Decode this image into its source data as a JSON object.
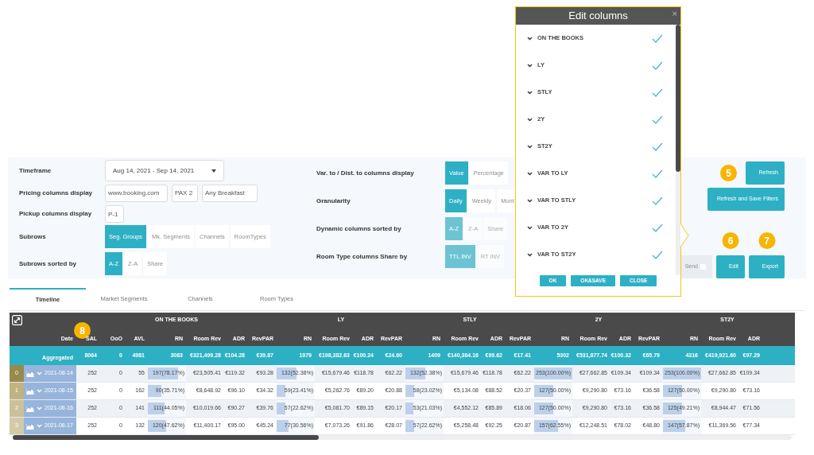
{
  "filters_left": [
    {
      "kind": "dropdown",
      "label": "Timeframe",
      "value": "Aug 14, 2021 - Sep 14, 2021"
    },
    {
      "kind": "fields",
      "label": "Pricing columns display",
      "values": [
        "www.booking.com",
        "PAX 2",
        "Any Breakfast"
      ]
    },
    {
      "kind": "fields",
      "label": "Pickup columns display",
      "values": [
        "P-1"
      ]
    },
    {
      "kind": "segmented",
      "label": "Subrows",
      "disabled": false,
      "options": [
        {
          "label": "Seg. Groups",
          "selected": true
        },
        {
          "label": "Mk. Segments",
          "selected": false
        },
        {
          "label": "Channels",
          "selected": false
        },
        {
          "label": "RoomTypes",
          "selected": false
        }
      ]
    },
    {
      "kind": "segmented",
      "label": "Subrows sorted by",
      "disabled": false,
      "options": [
        {
          "label": "A-Z",
          "selected": true
        },
        {
          "label": "Z-A",
          "selected": false
        },
        {
          "label": "Share",
          "selected": false
        }
      ]
    }
  ],
  "filters_middle": [
    {
      "kind": "segmented",
      "label": "Var. to / Dist. to columns display",
      "disabled": false,
      "options": [
        {
          "label": "Value",
          "selected": true
        },
        {
          "label": "Percentage",
          "selected": false
        }
      ]
    },
    {
      "kind": "segmented",
      "label": "Granularity",
      "disabled": false,
      "options": [
        {
          "label": "Daily",
          "selected": true
        },
        {
          "label": "Weekly",
          "selected": false
        },
        {
          "label": "Mont",
          "selected": false
        }
      ]
    },
    {
      "kind": "segmented",
      "label": "Dynamic columns sorted by",
      "disabled": true,
      "options": [
        {
          "label": "A-Z",
          "selected": true
        },
        {
          "label": "Z-A",
          "selected": false
        },
        {
          "label": "Share",
          "selected": false
        }
      ]
    },
    {
      "kind": "segmented",
      "label": "Room Type columns Share by",
      "disabled": true,
      "options": [
        {
          "label": "TTL INV",
          "selected": true
        },
        {
          "label": "RT INV",
          "selected": false
        }
      ]
    }
  ],
  "actions": {
    "top": [
      {
        "label": "Refresh",
        "callout": "5",
        "disabled": false
      },
      {
        "label": "Refresh and Save Filters",
        "disabled": false
      }
    ],
    "bottom": [
      {
        "label": "Send",
        "disabled": true
      },
      {
        "label": "Edit",
        "callout": "6",
        "disabled": false
      },
      {
        "label": "Export",
        "callout": "7",
        "disabled": false
      }
    ]
  },
  "tabs": [
    {
      "label": "Timeline",
      "selected": true
    },
    {
      "label": "Market Segments",
      "selected": false
    },
    {
      "label": "Channels",
      "selected": false
    },
    {
      "label": "Room Types",
      "selected": false
    }
  ],
  "table": {
    "lead_columns": [
      {
        "label": "Date",
        "callout": "8"
      },
      {
        "label": "SAL"
      },
      {
        "label": "OoO"
      },
      {
        "label": "AVL"
      }
    ],
    "groups": [
      {
        "label": "ON THE BOOKS",
        "columns": [
          "RN",
          "Room Rev",
          "ADR",
          "RevPAR"
        ]
      },
      {
        "label": "LY",
        "columns": [
          "RN",
          "Room Rev",
          "ADR",
          "RevPAR"
        ]
      },
      {
        "label": "STLY",
        "columns": [
          "RN",
          "Room Rev",
          "ADR",
          "RevPAR"
        ]
      },
      {
        "label": "2Y",
        "columns": [
          "RN",
          "Room Rev",
          "ADR",
          "RevPAR"
        ]
      },
      {
        "label": "ST2Y",
        "columns": [
          "RN",
          "Room Rev",
          "ADR"
        ]
      }
    ],
    "aggregated": {
      "label": "Aggregated",
      "cells": [
        "8064",
        "0",
        "4981",
        "3083",
        "€321,499.28",
        "€104.28",
        "€39.87",
        "1979",
        "€198,382.63",
        "€100.24",
        "€24.60",
        "1409",
        "€140,364.16",
        "€99.62",
        "€17.41",
        "5302",
        "€531,877.74",
        "€100.32",
        "€65.79",
        "4316",
        "€419,921.60",
        "€97.29"
      ]
    },
    "rows": [
      {
        "index": "0",
        "color": "#978a4c",
        "date": "2021-08-14",
        "cells": [
          "252",
          "0",
          "55",
          {
            "text": "197(78.17%)",
            "level": 0.7817
          },
          "€23,505.41",
          "€119.32",
          "€93.28",
          {
            "text": "132(52.38%)",
            "level": 0.5238
          },
          "€15,679.46",
          "€118.78",
          "€62.22",
          {
            "text": "132(52.38%)",
            "level": 0.5238
          },
          "€15,679.46",
          "€118.78",
          "€62.22",
          {
            "text": "253(100.00%)",
            "level": 1
          },
          "€27,662.85",
          "€109.34",
          "€109.34",
          {
            "text": "253(100.00%)",
            "level": 1
          },
          "€27,662.85",
          "€109.34"
        ]
      },
      {
        "index": "1",
        "color": "#bfb380",
        "date": "2021-08-15",
        "cells": [
          "252",
          "0",
          "162",
          {
            "text": "90(35.71%)",
            "level": 0.3571
          },
          "€8,648.92",
          "€96.10",
          "€34.32",
          {
            "text": "59(23.41%)",
            "level": 0.2341
          },
          "€5,262.76",
          "€89.20",
          "€20.88",
          {
            "text": "58(23.02%)",
            "level": 0.2302
          },
          "€5,134.08",
          "€88.52",
          "€20.37",
          {
            "text": "127(50.00%)",
            "level": 0.5
          },
          "€9,290.80",
          "€73.16",
          "€36.58",
          {
            "text": "127(50.00%)",
            "level": 0.5
          },
          "€9,290.80",
          "€73.16"
        ]
      },
      {
        "index": "2",
        "color": "#cbc199",
        "date": "2021-08-16",
        "cells": [
          "252",
          "0",
          "141",
          {
            "text": "111(44.05%)",
            "level": 0.4405
          },
          "€10,019.66",
          "€90.27",
          "€39.76",
          {
            "text": "57(22.62%)",
            "level": 0.2262
          },
          "€5,081.70",
          "€89.15",
          "€20.17",
          {
            "text": "53(21.03%)",
            "level": 0.2103
          },
          "€4,552.12",
          "€85.89",
          "€18.06",
          {
            "text": "127(50.00%)",
            "level": 0.5
          },
          "€9,290.80",
          "€73.16",
          "€36.58",
          {
            "text": "125(49.21%)",
            "level": 0.4921
          },
          "€8,944.47",
          "€71.56"
        ]
      },
      {
        "index": "3",
        "color": "#d3cba7",
        "date": "2021-08-17",
        "cells": [
          "252",
          "0",
          "132",
          {
            "text": "120(47.62%)",
            "level": 0.4762
          },
          "€11,400.17",
          "€95.00",
          "€45.24",
          {
            "text": "77(30.56%)",
            "level": 0.3056
          },
          "€7,073.26",
          "€91.86",
          "€28.07",
          {
            "text": "57(22.62%)",
            "level": 0.2262
          },
          "€5,258.48",
          "€92.25",
          "€20.87",
          {
            "text": "157(62.55%)",
            "level": 0.6255
          },
          "€12,248.51",
          "€78.02",
          "€48.80",
          {
            "text": "147(57.87%)",
            "level": 0.5787
          },
          "€11,369.56",
          "€77.34"
        ]
      }
    ]
  },
  "edit_columns_dialog": {
    "title": "Edit columns",
    "close": "×",
    "items": [
      {
        "label": "ON THE BOOKS",
        "checked": true
      },
      {
        "label": "LY",
        "checked": true
      },
      {
        "label": "STLY",
        "checked": true
      },
      {
        "label": "2Y",
        "checked": true
      },
      {
        "label": "ST2Y",
        "checked": true
      },
      {
        "label": "VAR TO LY",
        "checked": true
      },
      {
        "label": "VAR TO STLY",
        "checked": true
      },
      {
        "label": "VAR TO 2Y",
        "checked": true
      },
      {
        "label": "VAR TO ST2Y",
        "checked": true
      }
    ],
    "buttons": [
      "OK",
      "OK&SAVE",
      "CLOSE"
    ]
  }
}
